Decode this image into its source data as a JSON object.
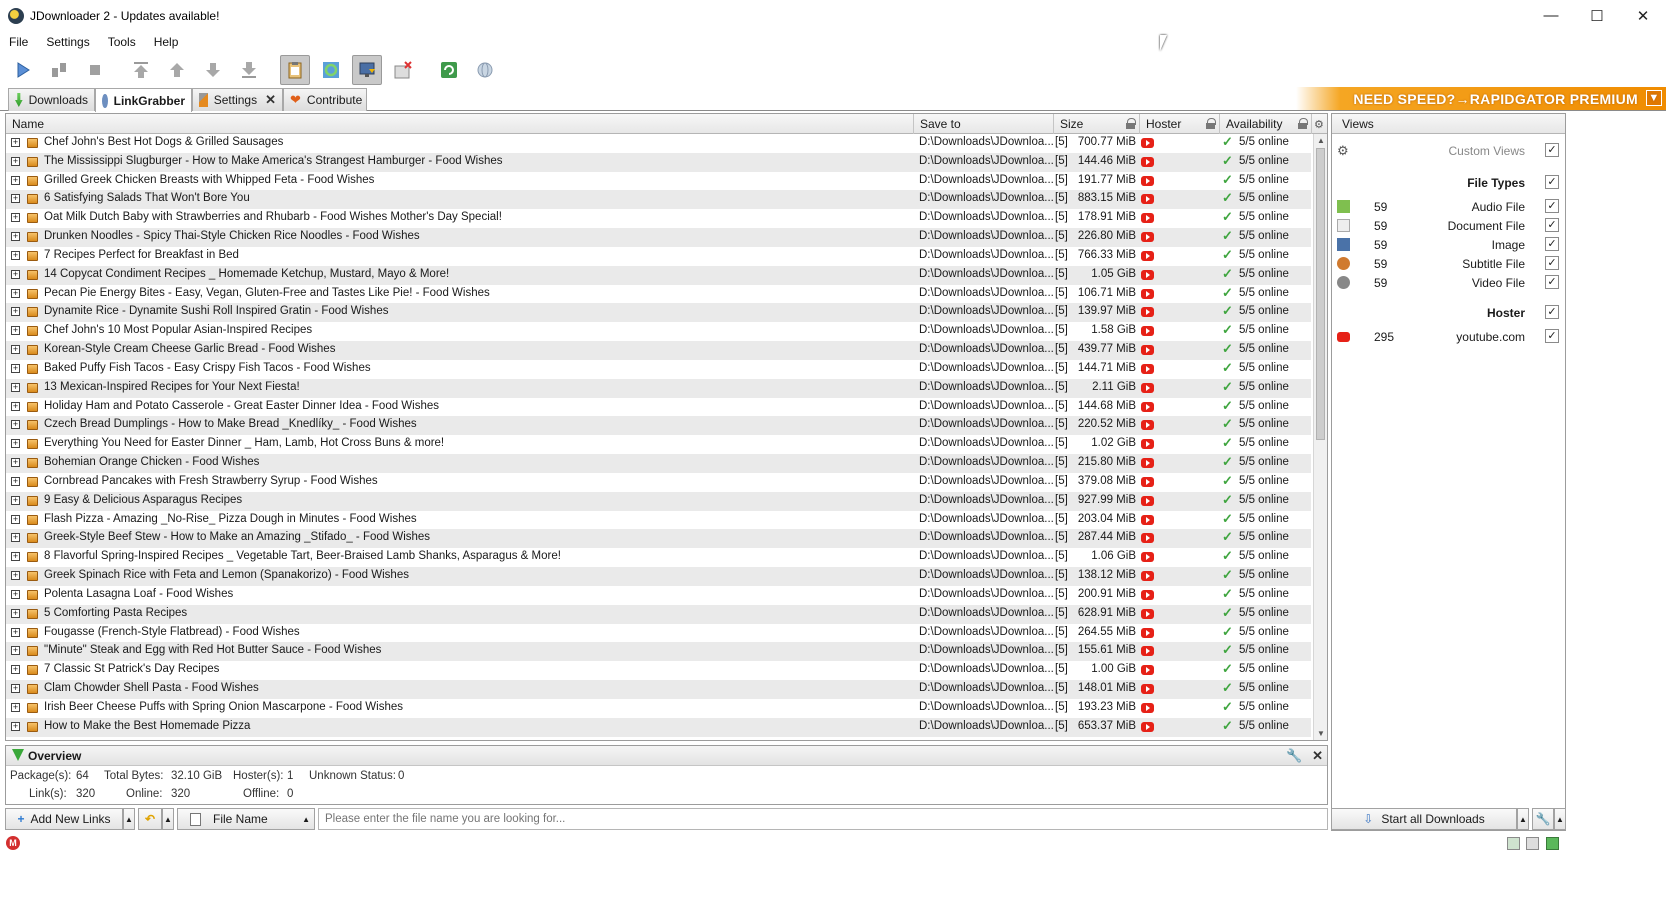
{
  "window": {
    "title": "JDownloader 2 - Updates available!",
    "minimize": "—",
    "maximize": "☐",
    "close": "✕"
  },
  "menu": [
    "File",
    "Settings",
    "Tools",
    "Help"
  ],
  "tabs": [
    {
      "label": "Downloads"
    },
    {
      "label": "LinkGrabber"
    },
    {
      "label": "Settings"
    },
    {
      "label": "Contribute"
    }
  ],
  "banner": {
    "text": "NEED SPEED?→RAPIDGATOR PREMIUM"
  },
  "table": {
    "columns": {
      "name": "Name",
      "save_to": "Save to",
      "size": "Size",
      "hoster": "Hoster",
      "availability": "Availability"
    },
    "rows": [
      {
        "name": "Chef John's Best Hot Dogs & Grilled Sausages",
        "save_to": "D:\\Downloads\\JDownloa...",
        "count": "[5]",
        "size": "700.77 MiB",
        "availability": "5/5 online"
      },
      {
        "name": "The Mississippi Slugburger - How to Make America's Strangest Hamburger - Food Wishes",
        "save_to": "D:\\Downloads\\JDownloa...",
        "count": "[5]",
        "size": "144.46 MiB",
        "availability": "5/5 online"
      },
      {
        "name": "Grilled Greek Chicken Breasts with Whipped Feta - Food Wishes",
        "save_to": "D:\\Downloads\\JDownloa...",
        "count": "[5]",
        "size": "191.77 MiB",
        "availability": "5/5 online"
      },
      {
        "name": "6 Satisfying Salads That Won't Bore You",
        "save_to": "D:\\Downloads\\JDownloa...",
        "count": "[5]",
        "size": "883.15 MiB",
        "availability": "5/5 online"
      },
      {
        "name": "Oat Milk Dutch Baby with Strawberries and Rhubarb - Food Wishes Mother's Day Special!",
        "save_to": "D:\\Downloads\\JDownloa...",
        "count": "[5]",
        "size": "178.91 MiB",
        "availability": "5/5 online"
      },
      {
        "name": "Drunken Noodles - Spicy Thai-Style Chicken Rice Noodles - Food Wishes",
        "save_to": "D:\\Downloads\\JDownloa...",
        "count": "[5]",
        "size": "226.80 MiB",
        "availability": "5/5 online"
      },
      {
        "name": "7 Recipes Perfect for Breakfast in Bed",
        "save_to": "D:\\Downloads\\JDownloa...",
        "count": "[5]",
        "size": "766.33 MiB",
        "availability": "5/5 online"
      },
      {
        "name": "14 Copycat Condiment Recipes _ Homemade Ketchup, Mustard, Mayo & More!",
        "save_to": "D:\\Downloads\\JDownloa...",
        "count": "[5]",
        "size": "1.05 GiB",
        "availability": "5/5 online"
      },
      {
        "name": "Pecan Pie Energy Bites - Easy, Vegan, Gluten-Free and Tastes Like Pie! - Food Wishes",
        "save_to": "D:\\Downloads\\JDownloa...",
        "count": "[5]",
        "size": "106.71 MiB",
        "availability": "5/5 online"
      },
      {
        "name": "Dynamite Rice - Dynamite Sushi Roll Inspired Gratin - Food Wishes",
        "save_to": "D:\\Downloads\\JDownloa...",
        "count": "[5]",
        "size": "139.97 MiB",
        "availability": "5/5 online"
      },
      {
        "name": "Chef John's 10 Most Popular Asian-Inspired Recipes",
        "save_to": "D:\\Downloads\\JDownloa...",
        "count": "[5]",
        "size": "1.58 GiB",
        "availability": "5/5 online"
      },
      {
        "name": "Korean-Style Cream Cheese Garlic Bread - Food Wishes",
        "save_to": "D:\\Downloads\\JDownloa...",
        "count": "[5]",
        "size": "439.77 MiB",
        "availability": "5/5 online"
      },
      {
        "name": "Baked Puffy Fish Tacos - Easy Crispy Fish Tacos - Food Wishes",
        "save_to": "D:\\Downloads\\JDownloa...",
        "count": "[5]",
        "size": "144.71 MiB",
        "availability": "5/5 online"
      },
      {
        "name": "13 Mexican-Inspired Recipes for Your Next Fiesta!",
        "save_to": "D:\\Downloads\\JDownloa...",
        "count": "[5]",
        "size": "2.11 GiB",
        "availability": "5/5 online"
      },
      {
        "name": "Holiday Ham and Potato Casserole - Great Easter Dinner Idea - Food Wishes",
        "save_to": "D:\\Downloads\\JDownloa...",
        "count": "[5]",
        "size": "144.68 MiB",
        "availability": "5/5 online"
      },
      {
        "name": "Czech Bread Dumplings - How to Make Bread _Knedlíky_ - Food Wishes",
        "save_to": "D:\\Downloads\\JDownloa...",
        "count": "[5]",
        "size": "220.52 MiB",
        "availability": "5/5 online"
      },
      {
        "name": "Everything You Need for Easter Dinner _ Ham, Lamb, Hot Cross Buns & more!",
        "save_to": "D:\\Downloads\\JDownloa...",
        "count": "[5]",
        "size": "1.02 GiB",
        "availability": "5/5 online"
      },
      {
        "name": "Bohemian Orange Chicken - Food Wishes",
        "save_to": "D:\\Downloads\\JDownloa...",
        "count": "[5]",
        "size": "215.80 MiB",
        "availability": "5/5 online"
      },
      {
        "name": "Cornbread Pancakes with Fresh Strawberry Syrup - Food Wishes",
        "save_to": "D:\\Downloads\\JDownloa...",
        "count": "[5]",
        "size": "379.08 MiB",
        "availability": "5/5 online"
      },
      {
        "name": "9 Easy & Delicious Asparagus Recipes",
        "save_to": "D:\\Downloads\\JDownloa...",
        "count": "[5]",
        "size": "927.99 MiB",
        "availability": "5/5 online"
      },
      {
        "name": "Flash Pizza - Amazing _No-Rise_ Pizza Dough in Minutes - Food Wishes",
        "save_to": "D:\\Downloads\\JDownloa...",
        "count": "[5]",
        "size": "203.04 MiB",
        "availability": "5/5 online"
      },
      {
        "name": "Greek-Style Beef Stew - How to Make an Amazing _Stifado_ - Food Wishes",
        "save_to": "D:\\Downloads\\JDownloa...",
        "count": "[5]",
        "size": "287.44 MiB",
        "availability": "5/5 online"
      },
      {
        "name": "8 Flavorful Spring-Inspired Recipes _ Vegetable Tart, Beer-Braised Lamb Shanks, Asparagus & More!",
        "save_to": "D:\\Downloads\\JDownloa...",
        "count": "[5]",
        "size": "1.06 GiB",
        "availability": "5/5 online"
      },
      {
        "name": "Greek Spinach Rice with Feta and Lemon (Spanakorizo) - Food Wishes",
        "save_to": "D:\\Downloads\\JDownloa...",
        "count": "[5]",
        "size": "138.12 MiB",
        "availability": "5/5 online"
      },
      {
        "name": "Polenta Lasagna Loaf - Food Wishes",
        "save_to": "D:\\Downloads\\JDownloa...",
        "count": "[5]",
        "size": "200.91 MiB",
        "availability": "5/5 online"
      },
      {
        "name": "5 Comforting Pasta Recipes",
        "save_to": "D:\\Downloads\\JDownloa...",
        "count": "[5]",
        "size": "628.91 MiB",
        "availability": "5/5 online"
      },
      {
        "name": "Fougasse (French-Style Flatbread) - Food Wishes",
        "save_to": "D:\\Downloads\\JDownloa...",
        "count": "[5]",
        "size": "264.55 MiB",
        "availability": "5/5 online"
      },
      {
        "name": "\"Minute\" Steak and Egg with Red Hot Butter Sauce - Food Wishes",
        "save_to": "D:\\Downloads\\JDownloa...",
        "count": "[5]",
        "size": "155.61 MiB",
        "availability": "5/5 online"
      },
      {
        "name": "7 Classic St  Patrick's Day Recipes",
        "save_to": "D:\\Downloads\\JDownloa...",
        "count": "[5]",
        "size": "1.00 GiB",
        "availability": "5/5 online"
      },
      {
        "name": "Clam Chowder Shell Pasta - Food Wishes",
        "save_to": "D:\\Downloads\\JDownloa...",
        "count": "[5]",
        "size": "148.01 MiB",
        "availability": "5/5 online"
      },
      {
        "name": "Irish Beer Cheese Puffs with Spring Onion Mascarpone - Food Wishes",
        "save_to": "D:\\Downloads\\JDownloa...",
        "count": "[5]",
        "size": "193.23 MiB",
        "availability": "5/5 online"
      },
      {
        "name": "How to Make the Best Homemade Pizza",
        "save_to": "D:\\Downloads\\JDownloa...",
        "count": "[5]",
        "size": "653.37 MiB",
        "availability": "5/5 online"
      }
    ]
  },
  "views": {
    "title": "Views",
    "custom_views": "Custom Views",
    "file_types_header": "File Types",
    "file_types": [
      {
        "label": "Audio File",
        "count": "59"
      },
      {
        "label": "Document File",
        "count": "59"
      },
      {
        "label": "Image",
        "count": "59"
      },
      {
        "label": "Subtitle File",
        "count": "59"
      },
      {
        "label": "Video File",
        "count": "59"
      }
    ],
    "hoster_header": "Hoster",
    "hosters": [
      {
        "label": "youtube.com",
        "count": "295"
      }
    ]
  },
  "overview": {
    "title": "Overview",
    "packages_label": "Package(s):",
    "packages": "64",
    "total_bytes_label": "Total Bytes:",
    "total_bytes": "32.10 GiB",
    "hosters_label": "Hoster(s):",
    "hosters": "1",
    "unknown_label": "Unknown Status:",
    "unknown": "0",
    "links_label": "Link(s):",
    "links": "320",
    "online_label": "Online:",
    "online": "320",
    "offline_label": "Offline:",
    "offline": "0"
  },
  "bottom": {
    "add_links": "Add New Links",
    "sort_field": "File Name",
    "search_placeholder": "Please enter the file name you are looking for...",
    "start_all": "Start all Downloads"
  },
  "colors": {
    "youtube": "#e62117",
    "online_check": "#3fa53f",
    "banner": "#f08c00"
  }
}
